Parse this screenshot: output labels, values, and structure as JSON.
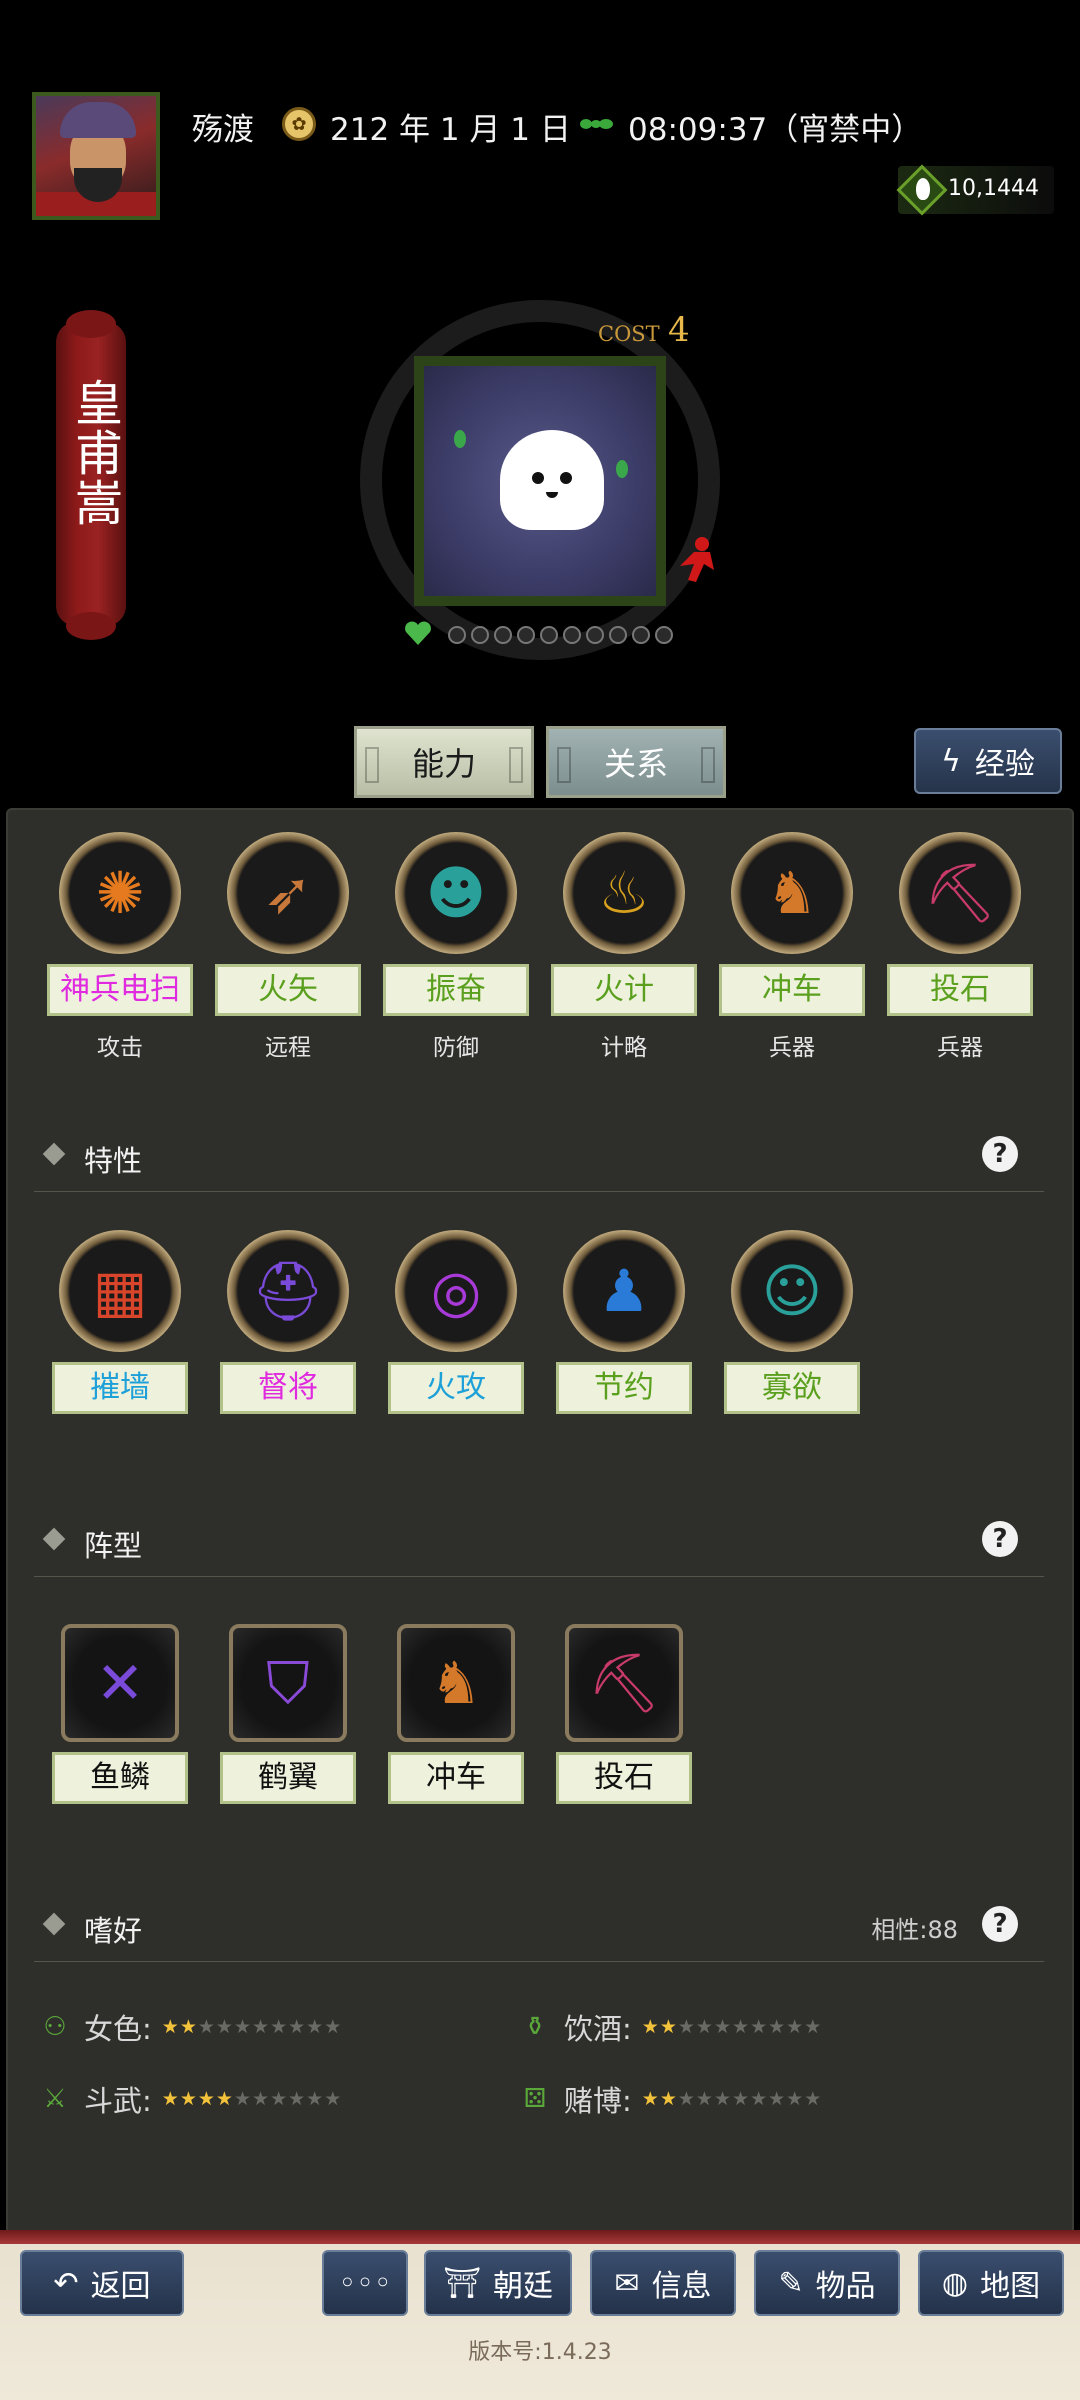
{
  "header": {
    "location": "殇渡",
    "date": "212 年 1 月 1 日",
    "time": "08:09:37（宵禁中）",
    "money": "10,1444"
  },
  "general": {
    "name": "皇甫嵩",
    "cost_label": "COST",
    "cost_value": "4",
    "level_dots": 10
  },
  "tabs": {
    "ability": "能力",
    "relation": "关系",
    "exp": "经验"
  },
  "skills": [
    {
      "label": "神兵电扫",
      "category": "攻击",
      "color": "#e02ae0",
      "icon": "burst-icon",
      "glyph": "✺",
      "icon_color": "#e57a1e"
    },
    {
      "label": "火矢",
      "category": "远程",
      "color": "#5aa01e",
      "icon": "arrow-icon",
      "glyph": "➶",
      "icon_color": "#c8783a"
    },
    {
      "label": "振奋",
      "category": "防御",
      "color": "#5aa01e",
      "icon": "shout-icon",
      "glyph": "☻",
      "icon_color": "#2aa09a"
    },
    {
      "label": "火计",
      "category": "计略",
      "color": "#5aa01e",
      "icon": "flame-icon",
      "glyph": "♨",
      "icon_color": "#d8a21e"
    },
    {
      "label": "冲车",
      "category": "兵器",
      "color": "#5aa01e",
      "icon": "ram-icon",
      "glyph": "♞",
      "icon_color": "#d4782a"
    },
    {
      "label": "投石",
      "category": "兵器",
      "color": "#5aa01e",
      "icon": "catapult-icon",
      "glyph": "⛏",
      "icon_color": "#c83a6a"
    }
  ],
  "traits": {
    "title": "特性",
    "help": "?",
    "items": [
      {
        "label": "摧墙",
        "color": "#1ea0d8",
        "icon": "wall-icon",
        "glyph": "▦",
        "icon_color": "#d8452a"
      },
      {
        "label": "督将",
        "color": "#e02ae0",
        "icon": "helmet-icon",
        "glyph": "⛑",
        "icon_color": "#7a4ad8"
      },
      {
        "label": "火攻",
        "color": "#1ea0d8",
        "icon": "fire-ring-icon",
        "glyph": "◎",
        "icon_color": "#a83ad8"
      },
      {
        "label": "节约",
        "color": "#5aa01e",
        "icon": "piggy-bank-icon",
        "glyph": "♟",
        "icon_color": "#2a7ad8"
      },
      {
        "label": "寡欲",
        "color": "#5aa01e",
        "icon": "meditate-icon",
        "glyph": "☺",
        "icon_color": "#2aa09a"
      }
    ]
  },
  "formations": {
    "title": "阵型",
    "help": "?",
    "items": [
      {
        "label": "鱼鳞",
        "icon": "scales-icon",
        "glyph": "✕",
        "icon_color": "#7a4ad8"
      },
      {
        "label": "鹤翼",
        "icon": "wing-icon",
        "glyph": "⛉",
        "icon_color": "#8a4ad8"
      },
      {
        "label": "冲车",
        "icon": "ram-icon",
        "glyph": "♞",
        "icon_color": "#d4782a"
      },
      {
        "label": "投石",
        "icon": "catapult-icon",
        "glyph": "⛏",
        "icon_color": "#c83a6a"
      }
    ]
  },
  "hobbies": {
    "title": "嗜好",
    "affinity": "相性:88",
    "help": "?",
    "items": [
      {
        "label": "女色:",
        "icon": "sandals-icon",
        "glyph": "⚇",
        "stars": 2
      },
      {
        "label": "饮酒:",
        "icon": "wine-bottle-icon",
        "glyph": "⚱",
        "stars": 2
      },
      {
        "label": "斗武:",
        "icon": "crossed-swords-icon",
        "glyph": "⚔",
        "stars": 4
      },
      {
        "label": "赌博:",
        "icon": "dice-icon",
        "glyph": "⚄",
        "stars": 2
      }
    ],
    "max_stars": 10
  },
  "footer": {
    "back": "返回",
    "more": "◦◦◦",
    "court": "朝廷",
    "info": "信息",
    "items": "物品",
    "map": "地图",
    "version": "版本号:1.4.23"
  }
}
